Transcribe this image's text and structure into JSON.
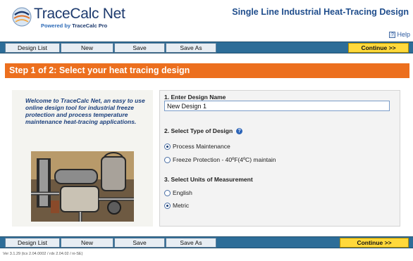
{
  "header": {
    "logo_title": "TraceCalc Net",
    "logo_powered_by": "Powered by",
    "logo_product": "TraceCalc Pro",
    "page_heading": "Single Line Industrial Heat-Tracing Design",
    "help_label": "Help"
  },
  "nav": {
    "design_list": "Design List",
    "new": "New",
    "save": "Save",
    "save_as": "Save As",
    "continue": "Continue >>"
  },
  "step_title": "Step 1 of 2: Select your heat tracing design",
  "welcome_text": "Welcome to TraceCalc Net, an easy to use online design tool for industrial freeze protection and process temperature maintenance heat-tracing applications.",
  "form": {
    "design_name_label": "1. Enter Design Name",
    "design_name_value": "New Design 1",
    "design_type_label": "2. Select Type of Design",
    "design_types": [
      {
        "label": "Process Maintenance",
        "checked": true
      },
      {
        "label": "Freeze Protection - 40ºF(4ºC) maintain",
        "checked": false
      }
    ],
    "units_label": "3. Select Units of Measurement",
    "units": [
      {
        "label": "English",
        "checked": false
      },
      {
        "label": "Metric",
        "checked": true
      }
    ]
  },
  "version": "Ver 3.1.29 (tcx 2.04.0002 / rdx 2.04.02 / ni-SE)",
  "colors": {
    "nav_bar": "#2d6d98",
    "step_bar": "#ec6f1e",
    "continue_button": "#ffd93b",
    "heading_text": "#1f4d8c"
  }
}
